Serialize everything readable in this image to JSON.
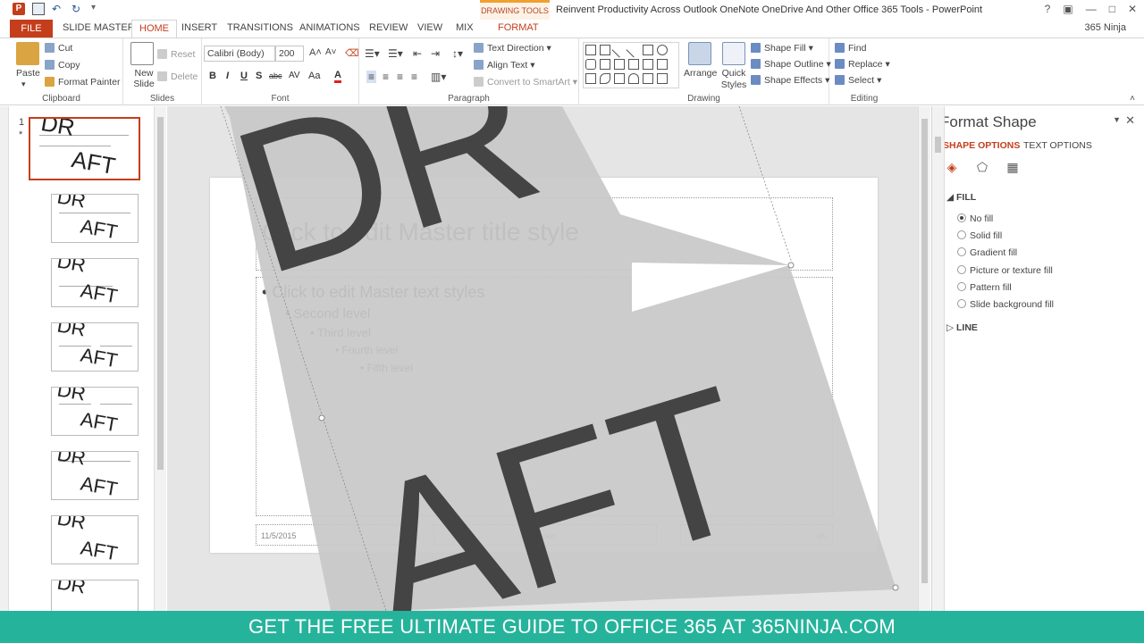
{
  "window": {
    "title": "Reinvent Productivity Across Outlook OneNote OneDrive And Other Office 365 Tools - PowerPoint",
    "context_tab": "DRAWING TOOLS",
    "account": "365 Ninja",
    "help": "?",
    "minimize": "—",
    "maximize": "□",
    "close": "✕"
  },
  "tabs": [
    "FILE",
    "SLIDE MASTER",
    "HOME",
    "INSERT",
    "TRANSITIONS",
    "ANIMATIONS",
    "REVIEW",
    "VIEW",
    "MIX",
    "FORMAT"
  ],
  "ribbon": {
    "clipboard": {
      "label": "Clipboard",
      "paste": "Paste",
      "cut": "Cut",
      "copy": "Copy",
      "format_painter": "Format Painter"
    },
    "slides": {
      "label": "Slides",
      "new_slide": "New Slide",
      "reset": "Reset",
      "delete": "Delete"
    },
    "font": {
      "label": "Font",
      "font_name": "Calibri (Body)",
      "font_size": "200",
      "bold": "B",
      "italic": "I",
      "underline": "U",
      "shadow": "S",
      "strike": "abc",
      "spacing": "AV",
      "case": "Aa",
      "color": "A"
    },
    "paragraph": {
      "label": "Paragraph",
      "text_direction": "Text Direction",
      "align_text": "Align Text",
      "convert_smartart": "Convert to SmartArt"
    },
    "drawing": {
      "label": "Drawing",
      "arrange": "Arrange",
      "quick_styles": "Quick Styles",
      "shape_fill": "Shape Fill",
      "shape_outline": "Shape Outline",
      "shape_effects": "Shape Effects"
    },
    "editing": {
      "label": "Editing",
      "find": "Find",
      "replace": "Replace",
      "select": "Select"
    }
  },
  "thumbnails": {
    "master_number": "1",
    "master_mark": "*"
  },
  "slide": {
    "title_placeholder": "Click to edit Master title style",
    "bullets": [
      {
        "text": "Click to edit Master text styles",
        "level": 1
      },
      {
        "text": "Second level",
        "level": 2
      },
      {
        "text": "Third level",
        "level": 3
      },
      {
        "text": "Fourth level",
        "level": 4
      },
      {
        "text": "Fifth level",
        "level": 5
      }
    ],
    "date": "11/5/2015",
    "footer": "Footer",
    "slide_number": "‹#›",
    "watermark_line1": "DR",
    "watermark_line2": "AFT"
  },
  "format_pane": {
    "title": "Format Shape",
    "tab_shape": "SHAPE OPTIONS",
    "tab_text": "TEXT OPTIONS",
    "fill_section": "FILL",
    "line_section": "LINE",
    "fill_options": [
      "No fill",
      "Solid fill",
      "Gradient fill",
      "Picture or texture fill",
      "Pattern fill",
      "Slide background fill"
    ],
    "selected_fill": "No fill"
  },
  "banner": "GET THE FREE ULTIMATE GUIDE TO OFFICE 365 AT 365NINJA.COM",
  "colors": {
    "accent": "#c43e1c",
    "banner": "#26b39c",
    "watermark": "#444444",
    "shape_fill": "#c8c8c8"
  }
}
